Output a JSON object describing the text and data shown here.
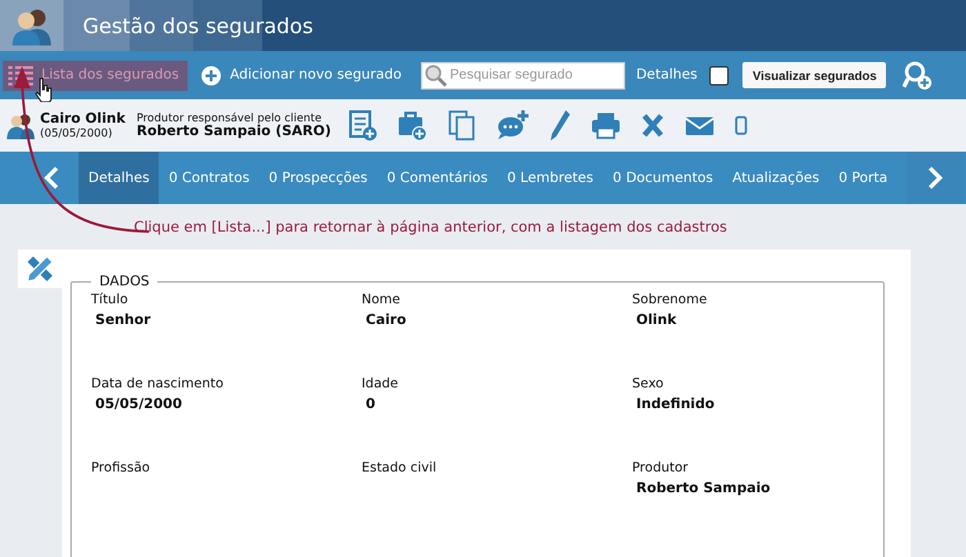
{
  "header": {
    "title": "Gestão dos segurados"
  },
  "toolbar": {
    "list_button": "Lista dos segurados",
    "add_button": "Adicionar novo segurado",
    "search": {
      "placeholder": "Pesquisar segurado"
    },
    "details_checkbox": {
      "label": "Detalhes",
      "checked": false
    },
    "view_button": "Visualizar segurados"
  },
  "client": {
    "name": "Cairo Olink",
    "birth": "(05/05/2000)",
    "producer_label": "Produtor responsável pelo cliente",
    "producer": "Roberto Sampaio (SARO)"
  },
  "tabs": [
    {
      "label": "Detalhes",
      "selected": true
    },
    {
      "label": "0 Contratos",
      "selected": false
    },
    {
      "label": "0 Prospecções",
      "selected": false
    },
    {
      "label": "0 Comentários",
      "selected": false
    },
    {
      "label": "0 Lembretes",
      "selected": false
    },
    {
      "label": "0 Documentos",
      "selected": false
    },
    {
      "label": "Atualizações",
      "selected": false
    },
    {
      "label": "0 Porta",
      "selected": false
    }
  ],
  "annotation": "Clique em [Lista...] para retornar à página anterior, com a listagem dos cadastros",
  "section": {
    "title": "DADOS",
    "fields": [
      {
        "label": "Título",
        "value": "Senhor"
      },
      {
        "label": "Nome",
        "value": "Cairo"
      },
      {
        "label": "Sobrenome",
        "value": "Olink"
      },
      {
        "label": "Data de nascimento",
        "value": "05/05/2000"
      },
      {
        "label": "Idade",
        "value": "0"
      },
      {
        "label": "Sexo",
        "value": "Indefinido"
      },
      {
        "label": "Profissão"
      },
      {
        "label": "Estado civil"
      },
      {
        "label": "Produtor",
        "value": "Roberto Sampaio"
      }
    ]
  }
}
